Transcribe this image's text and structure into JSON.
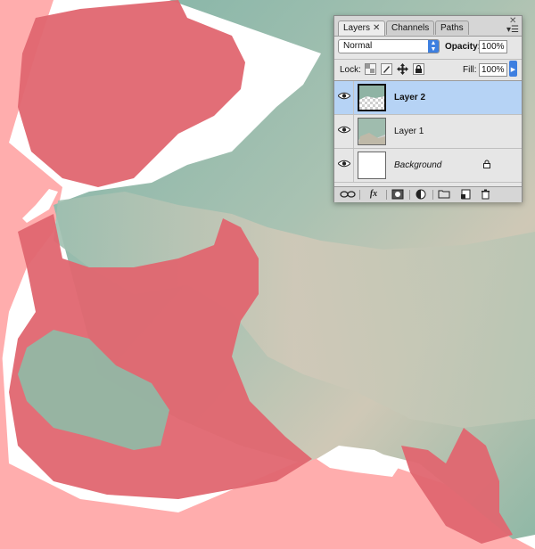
{
  "colors": {
    "canvas_pink": "#ffadad",
    "mask_red": "#e06670",
    "terrain_green": "#8fb8a8",
    "terrain_tan": "#c8c3b3",
    "selection_blue": "#b6d3f5",
    "accent_blue": "#3d7fe0"
  },
  "layers_panel": {
    "tabs": [
      {
        "label": "Layers",
        "active": true,
        "close": "✕"
      },
      {
        "label": "Channels",
        "active": false
      },
      {
        "label": "Paths",
        "active": false
      }
    ],
    "close_glyph": "✕",
    "menu_glyph": "▾☰",
    "blend_mode": "Normal",
    "opacity_label": "Opacity:",
    "opacity_value": "100%",
    "lock_label": "Lock:",
    "fill_label": "Fill:",
    "fill_value": "100%",
    "lock_icons": [
      "lock-transparent-icon",
      "lock-image-icon",
      "lock-position-icon",
      "lock-all-icon"
    ],
    "layers": [
      {
        "name": "Layer 2",
        "selected": true,
        "visible": true,
        "style": "bold"
      },
      {
        "name": "Layer 1",
        "selected": false,
        "visible": true,
        "style": "normal"
      },
      {
        "name": "Background",
        "selected": false,
        "visible": true,
        "style": "italic",
        "locked": true
      }
    ],
    "bottom_icons": [
      "link-layers-icon",
      "fx-icon",
      "add-mask-icon",
      "adjustment-layer-icon",
      "new-group-icon",
      "new-layer-icon",
      "trash-icon"
    ],
    "fx_label": "fx"
  }
}
